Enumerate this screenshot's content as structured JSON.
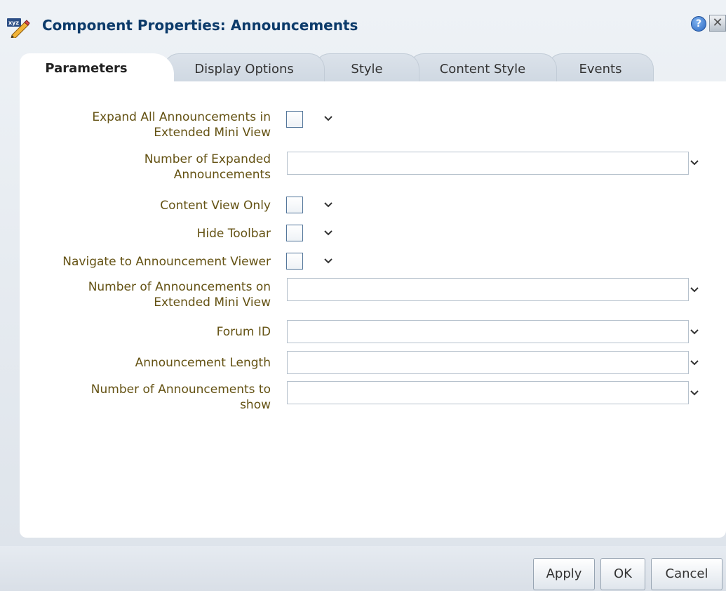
{
  "dialog": {
    "title": "Component Properties: Announcements",
    "title_icon": "component-xyz-pencil-icon",
    "help_glyph": "?",
    "close_glyph": "✕"
  },
  "tabs": [
    {
      "label": "Parameters",
      "active": true
    },
    {
      "label": "Display Options",
      "active": false
    },
    {
      "label": "Style",
      "active": false
    },
    {
      "label": "Content Style",
      "active": false
    },
    {
      "label": "Events",
      "active": false
    }
  ],
  "parameters": {
    "expand_all": {
      "label_line1": "Expand All Announcements in",
      "label_line2": "Extended Mini View",
      "checked": false
    },
    "num_expanded": {
      "label_line1": "Number of Expanded",
      "label_line2": "Announcements",
      "value": ""
    },
    "content_view_only": {
      "label": "Content View Only",
      "checked": false
    },
    "hide_toolbar": {
      "label": "Hide Toolbar",
      "checked": false
    },
    "navigate_viewer": {
      "label": "Navigate to Announcement Viewer",
      "checked": false
    },
    "num_on_extended": {
      "label_line1": "Number of Announcements on",
      "label_line2": "Extended Mini View",
      "value": ""
    },
    "forum_id": {
      "label": "Forum ID",
      "value": ""
    },
    "announcement_length": {
      "label": "Announcement Length",
      "value": ""
    },
    "num_to_show": {
      "label_line1": "Number of Announcements to",
      "label_line2": "show",
      "value": ""
    }
  },
  "footer": {
    "apply_label": "Apply",
    "ok_label": "OK",
    "cancel_label": "Cancel"
  },
  "colors": {
    "title": "#0b3a6a",
    "label": "#645213",
    "panel": "#ffffff",
    "background": "#e3e8ef"
  }
}
